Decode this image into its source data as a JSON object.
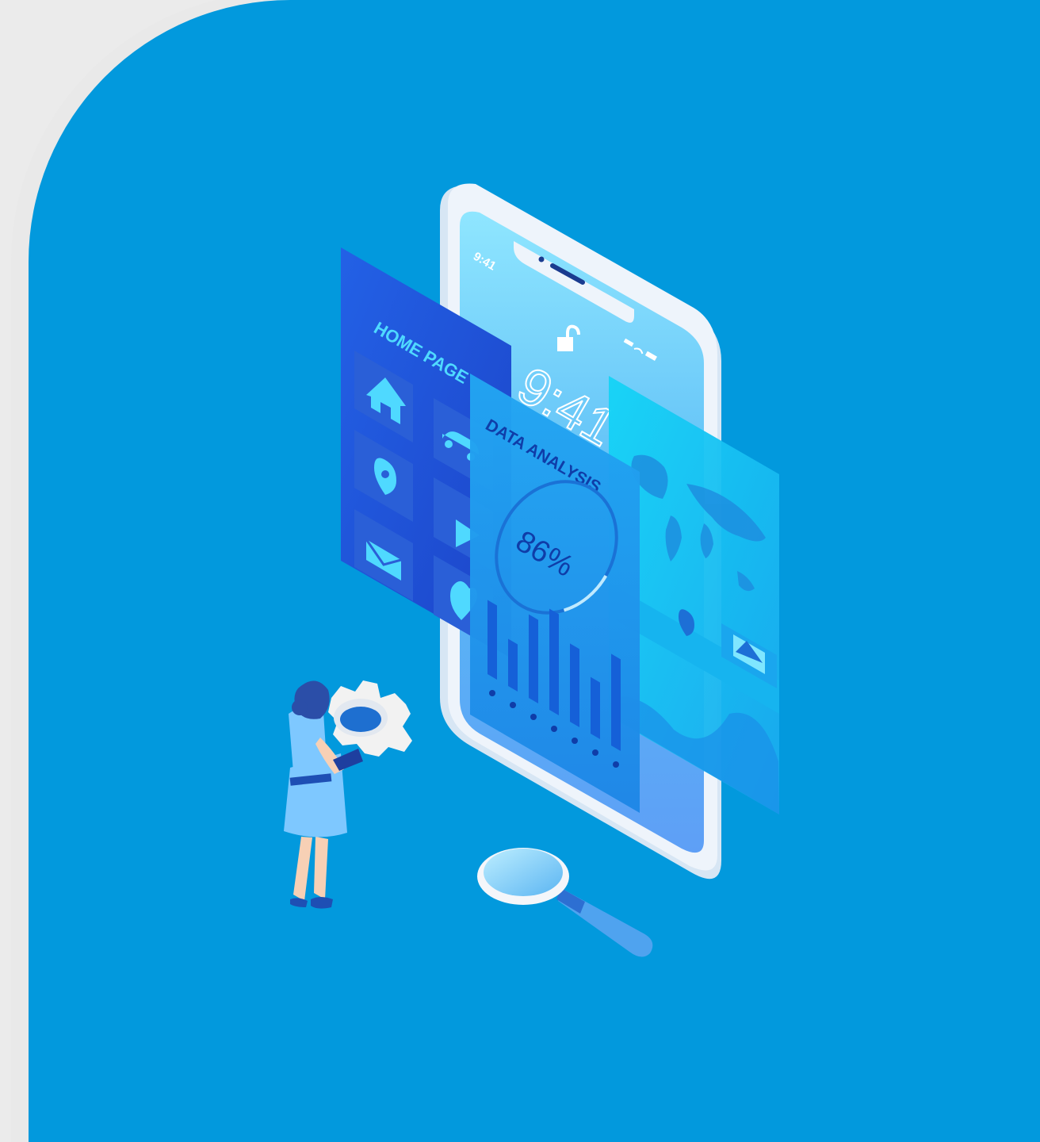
{
  "illustration": {
    "status_time": "9:41",
    "lock_time": "9:41",
    "home_panel_title": "HOME PAGE",
    "data_panel_title": "DATA ANALYSIS",
    "progress_percent": 86,
    "progress_label": "86%",
    "bar_values": [
      0.55,
      0.35,
      0.62,
      0.75,
      0.58,
      0.42,
      0.68
    ],
    "colors": {
      "background": "#0299dd",
      "outer_card": "#e9e9e9",
      "phone_frame": "#eef4fb",
      "home_panel": "#1d4fd8",
      "data_panel": "#1894ea",
      "map_panel": "#18c5f2"
    },
    "icons": [
      "home-icon",
      "car-icon",
      "location-pin-icon",
      "play-icon",
      "mail-icon",
      "heart-icon",
      "image-icon",
      "gear-icon",
      "magnifier-icon"
    ]
  }
}
